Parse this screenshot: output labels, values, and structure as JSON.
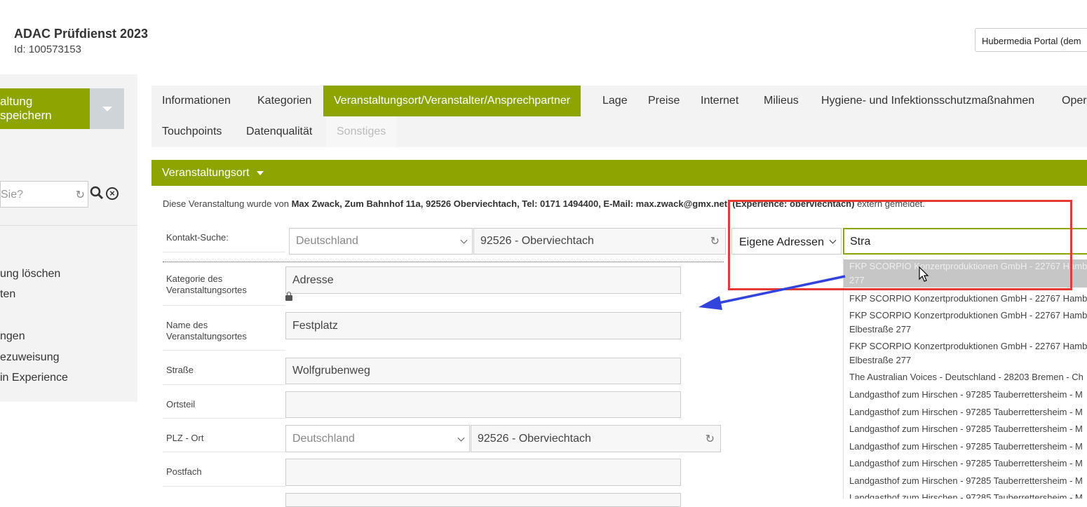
{
  "header": {
    "title": "ADAC Prüfdienst 2023",
    "id_line": "Id: 100573153",
    "portal_select": "Hubermedia Portal (dem"
  },
  "sidebar": {
    "save_label": "altung speichern",
    "search_placeholder": "Sie?",
    "links": [
      "ung löschen",
      "ten",
      "ngen",
      "ezuweisung",
      "in Experience"
    ]
  },
  "tabs": [
    {
      "label": "Informationen"
    },
    {
      "label": "Kategorien"
    },
    {
      "label": "Veranstaltungsort/Veranstalter/Ansprechpartner"
    },
    {
      "label": "Lage"
    },
    {
      "label": "Preise"
    },
    {
      "label": "Internet"
    },
    {
      "label": "Milieus"
    },
    {
      "label": "Hygiene- und Infektionsschutzmaßnahmen"
    },
    {
      "label": "Oper"
    },
    {
      "label": "Touchpoints"
    },
    {
      "label": "Datenqualität"
    },
    {
      "label": "Sonstiges"
    }
  ],
  "section": {
    "title": "Veranstaltungsort"
  },
  "notice": {
    "prefix": "Diese Veranstaltung wurde von ",
    "bold": "Max Zwack, Zum Bahnhof 11a, 92526 Oberviechtach, Tel: 0171 1494400, E-Mail: max.zwack@gmx.net, (Experience: oberviechtach)",
    "suffix": " extern gemeldet."
  },
  "contact_search": {
    "label": "Kontakt-Suche:",
    "country": "Deutschland",
    "place": "92526 - Oberviechtach",
    "address_source": "Eigene Adressen",
    "query": "Stra"
  },
  "form": {
    "category_label": "Kategorie des Veranstaltungsortes",
    "category_value": "Adresse",
    "name_label": "Name des Veranstaltungsortes",
    "name_value": "Festplatz",
    "street_label": "Straße",
    "street_value": "Wolfgrubenweg",
    "district_label": "Ortsteil",
    "district_value": "",
    "zip_label": "PLZ - Ort",
    "zip_country": "Deutschland",
    "zip_place": "92526 - Oberviechtach",
    "po_label": "Postfach",
    "po_value": ""
  },
  "dropdown": {
    "items": [
      "FKP SCORPIO Konzertproduktionen GmbH - 22767 Hamb",
      "277",
      "FKP SCORPIO Konzertproduktionen GmbH - 22767 Hamb",
      "FKP SCORPIO Konzertproduktionen GmbH - 22767 Hamb",
      "Elbestraße 277",
      "FKP SCORPIO Konzertproduktionen GmbH - 22767 Hamb",
      "Elbestraße 277",
      "The Australian Voices - Deutschland - 28203 Bremen - Ch",
      "Landgasthof zum Hirschen - 97285 Tauberrettersheim - M",
      "Landgasthof zum Hirschen - 97285 Tauberrettersheim - M",
      "Landgasthof zum Hirschen - 97285 Tauberrettersheim - M",
      "Landgasthof zum Hirschen - 97285 Tauberrettersheim - M",
      "Landgasthof zum Hirschen - 97285 Tauberrettersheim - M",
      "Landgasthof zum Hirschen - 97285 Tauberrettersheim - M",
      "Landgasthof zum Hirschen - 97285 Tauberrettersheim - M"
    ]
  },
  "colors": {
    "accent": "#8ea400",
    "annotation_box": "#e53935",
    "annotation_arrow": "#3344dd"
  }
}
